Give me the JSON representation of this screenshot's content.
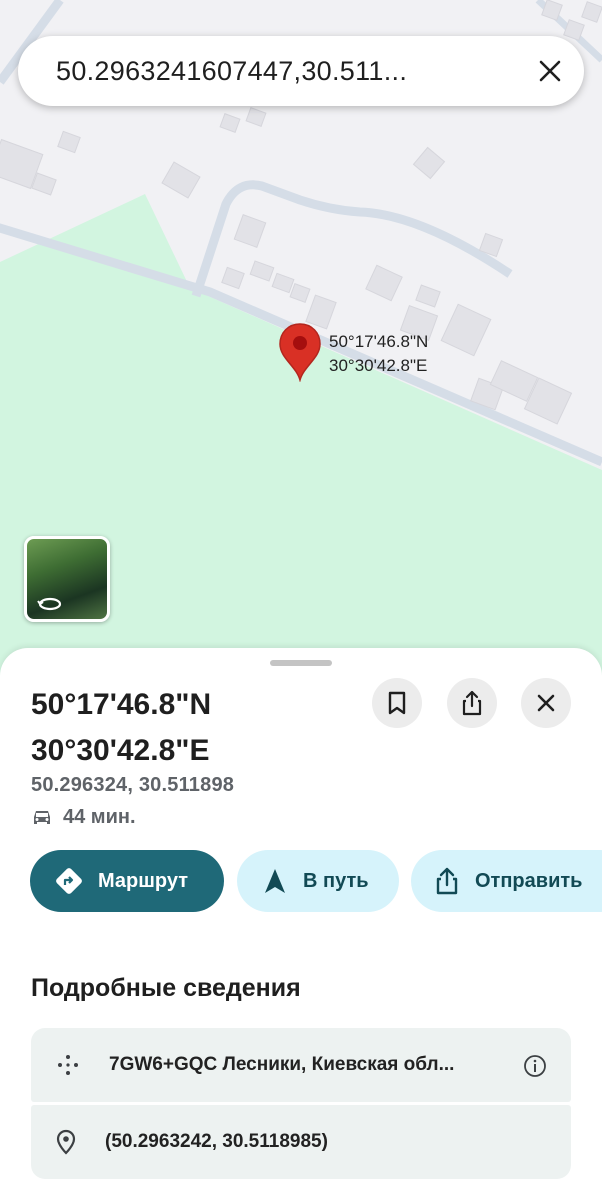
{
  "search": {
    "query": "50.2963241607447,30.511..."
  },
  "map": {
    "pin_label_line1": "50°17'46.8\"N",
    "pin_label_line2": "30°30'42.8\"E",
    "colors": {
      "park": "#d2f5e0",
      "land": "#f1f1f4",
      "road": "#d4dde8",
      "building": "#e3e3e8",
      "pin": "#d93025"
    }
  },
  "place": {
    "title_line1": "50°17'46.8\"N",
    "title_line2": "30°30'42.8\"E",
    "decimal": "50.296324, 30.511898",
    "eta": "44 мин."
  },
  "actions": {
    "route_label": "Маршрут",
    "go_label": "В путь",
    "share_label": "Отправить"
  },
  "details": {
    "heading": "Подробные сведения",
    "plus_code": "7GW6+GQC Лесники, Киевская обл...",
    "coordinates": "(50.2963242, 30.5118985)"
  },
  "icons": [
    "close-icon",
    "bookmark-icon",
    "share-icon",
    "car-icon",
    "directions-icon",
    "navigation-icon",
    "plus-code-icon",
    "info-icon",
    "location-pin-icon",
    "rotate-360-icon"
  ]
}
